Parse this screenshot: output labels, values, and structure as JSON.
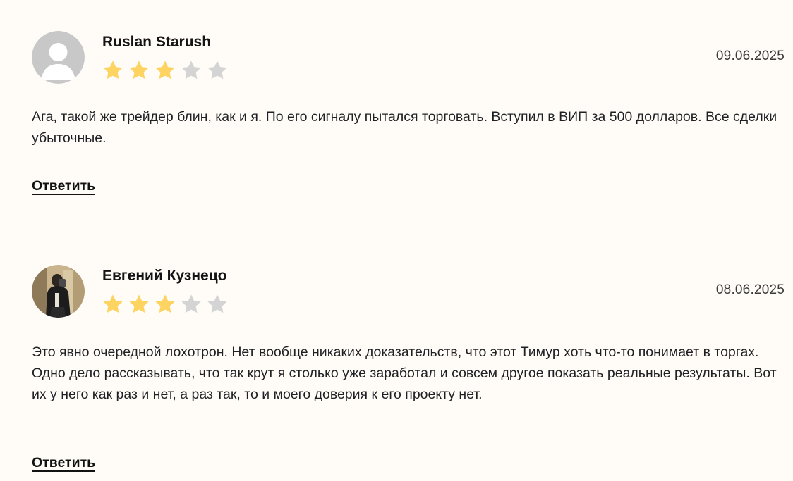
{
  "colors": {
    "background": "#fffbf7",
    "star_filled": "#fdd462",
    "star_empty": "#d4d4d4",
    "text": "#1f2024"
  },
  "reviews": [
    {
      "author": "Ruslan Starush",
      "avatar_icon": "default-user-avatar-icon",
      "rating": 3,
      "rating_max": 5,
      "date": "09.06.2025",
      "text": "Ага, такой же трейдер блин, как и я. По его сигналу пытался торговать. Вступил в ВИП за 500 долларов. Все сделки убыточные.",
      "reply_label": "Ответить"
    },
    {
      "author": "Евгений Кузнецо",
      "avatar_icon": "user-photo-avatar",
      "rating": 3,
      "rating_max": 5,
      "date": "08.06.2025",
      "text": "Это явно очередной лохотрон. Нет вообще никаких доказательств, что этот Тимур хоть что-то понимает в торгах. Одно дело рассказывать, что так крут я столько уже заработал и совсем другое показать реальные результаты. Вот их у него как раз и нет, а раз так, то и моего доверия к его проекту нет.",
      "reply_label": "Ответить"
    }
  ]
}
